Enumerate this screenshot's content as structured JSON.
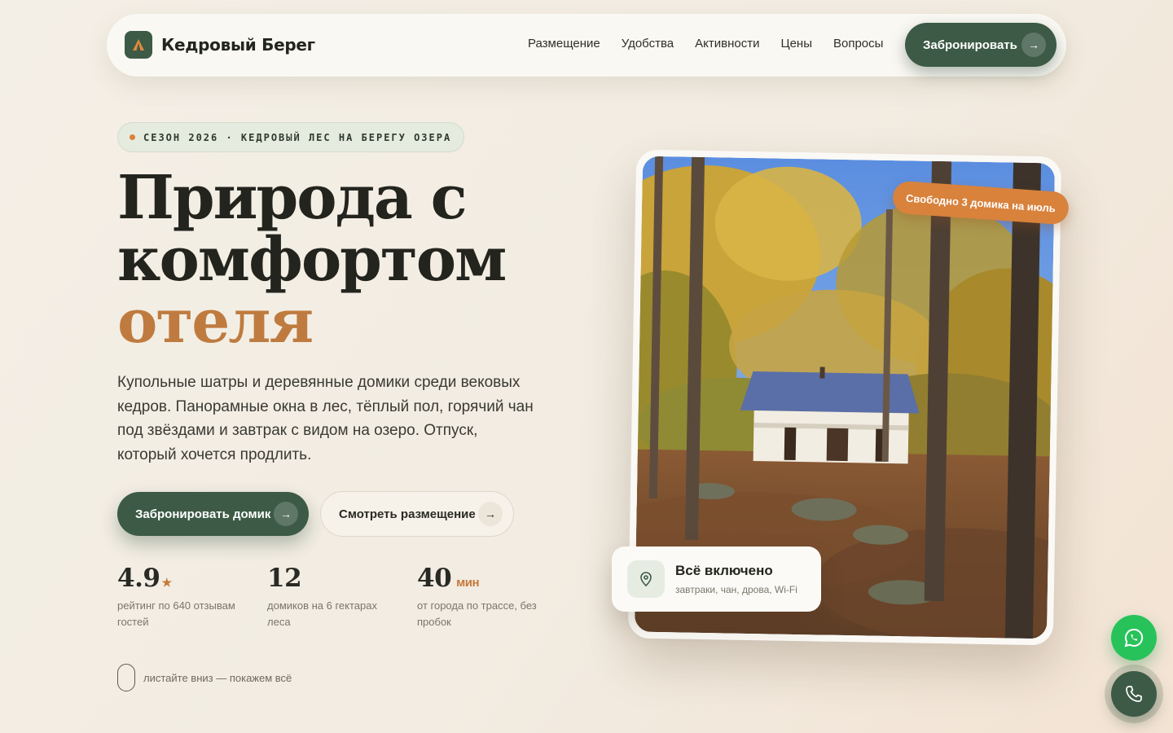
{
  "brand": {
    "name": "Кедровый Берег"
  },
  "nav": {
    "links": [
      "Размещение",
      "Удобства",
      "Активности",
      "Цены",
      "Вопросы"
    ],
    "cta_label": "Забронировать"
  },
  "hero": {
    "badge": "СЕЗОН 2026 · КЕДРОВЫЙ ЛЕС НА БЕРЕГУ ОЗЕРА",
    "title_line1": "Природа с",
    "title_line2": "комфортом",
    "title_accent": "отеля",
    "lead": "Купольные шатры и деревянные домики среди вековых кедров. Панорамные окна в лес, тёплый пол, горячий чан под звёздами и завтрак с видом на озеро. Отпуск, который хочется продлить.",
    "primary_button": "Забронировать домик",
    "secondary_button": "Смотреть размещение"
  },
  "stats": [
    {
      "value": "4.9",
      "suffix": "★",
      "label": "рейтинг по 640 отзывам гостей"
    },
    {
      "value": "12",
      "suffix": "",
      "label": "домиков на 6 гектарах леса"
    },
    {
      "value": "40",
      "suffix": "мин",
      "label": "от города по трассе, без пробок"
    }
  ],
  "scroll_hint": "листайте вниз — покажем всё",
  "photo": {
    "tag": "Свободно 3 домика на июль",
    "card_title": "Всё включено",
    "card_subtitle": "завтраки, чан, дрова, Wi-Fi"
  },
  "colors": {
    "brand_green": "#3c5a45",
    "accent_orange": "#d8823c",
    "whatsapp_green": "#27c35a"
  },
  "icons": {
    "arrow": "→",
    "logo": "tent-icon",
    "card": "location-pin-icon",
    "whatsapp": "whatsapp-icon",
    "phone": "phone-icon"
  }
}
